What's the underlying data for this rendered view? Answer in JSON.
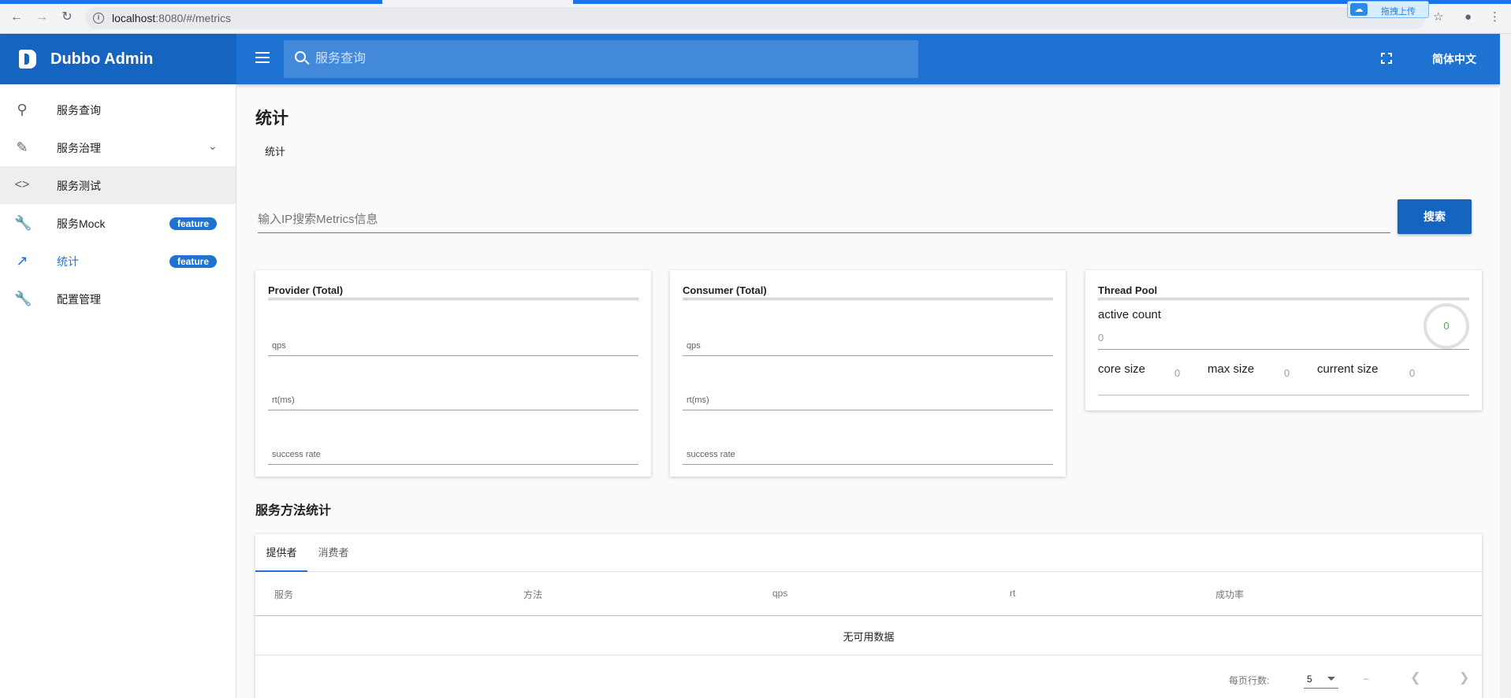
{
  "browser": {
    "url_host": "localhost",
    "url_path": ":8080/#/metrics",
    "extension_label": "拖拽上传"
  },
  "header": {
    "app_title": "Dubbo Admin",
    "search_placeholder": "服务查询",
    "language": "简体中文"
  },
  "sidebar": {
    "items": [
      {
        "label": "服务查询"
      },
      {
        "label": "服务治理"
      },
      {
        "label": "服务测试"
      },
      {
        "label": "服务Mock",
        "chip": "feature"
      },
      {
        "label": "统计",
        "chip": "feature"
      },
      {
        "label": "配置管理"
      }
    ]
  },
  "main": {
    "page_title": "统计",
    "breadcrumb": "统计",
    "ip_placeholder": "输入IP搜索Metrics信息",
    "search_button": "搜索"
  },
  "provider_card": {
    "title": "Provider (Total)",
    "fields": [
      "qps",
      "rt(ms)",
      "success rate"
    ]
  },
  "consumer_card": {
    "title": "Consumer (Total)",
    "fields": [
      "qps",
      "rt(ms)",
      "success rate"
    ]
  },
  "thread_pool": {
    "title": "Thread Pool",
    "active_label": "active count",
    "active_value": "0",
    "ring_value": "0",
    "core_label": "core size",
    "core_value": "0",
    "max_label": "max size",
    "max_value": "0",
    "current_label": "current size",
    "current_value": "0"
  },
  "method_stats": {
    "title": "服务方法统计",
    "tabs": [
      "提供者",
      "消费者"
    ],
    "columns": [
      "服务",
      "方法",
      "qps",
      "rt",
      "成功率"
    ],
    "empty_text": "无可用数据",
    "rows_per_page_label": "每页行数:",
    "rows_per_page_value": "5",
    "range_text": "–"
  },
  "colors": {
    "primary": "#1e73d2",
    "logo_bg": "#1565c0",
    "ring_value": "#4caf50"
  }
}
